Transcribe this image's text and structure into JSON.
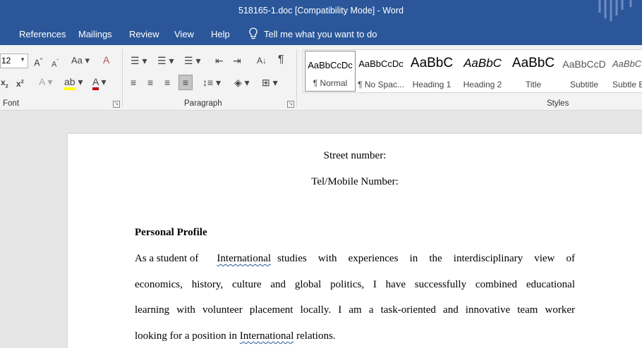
{
  "window": {
    "title": "518165-1.doc [Compatibility Mode]  -  Word"
  },
  "menu": {
    "tabs": [
      "References",
      "Mailings",
      "Review",
      "View",
      "Help"
    ],
    "tellme": "Tell me what you want to do"
  },
  "ribbon": {
    "font": {
      "size": "12",
      "group_label": "Font"
    },
    "paragraph": {
      "group_label": "Paragraph"
    },
    "styles": {
      "group_label": "Styles",
      "items": [
        {
          "preview": "AaBbCcDc",
          "name": "¶ Normal"
        },
        {
          "preview": "AaBbCcDc",
          "name": "¶ No Spac..."
        },
        {
          "preview": "AaBbC",
          "name": "Heading 1"
        },
        {
          "preview": "AaBbC",
          "name": "Heading 2"
        },
        {
          "preview": "AaBbC",
          "name": "Title"
        },
        {
          "preview": "AaBbCcD",
          "name": "Subtitle"
        },
        {
          "preview": "AaBbC",
          "name": "Subtle E"
        }
      ]
    }
  },
  "document": {
    "street": "Street number:",
    "tel": "Tel/Mobile Number:",
    "heading": "Personal Profile",
    "para": {
      "l1_a": "As a student of",
      "l1_b": "International",
      "l1_c": "studies with experiences in the interdisciplinary view of",
      "l2": "economics, history, culture and global politics, I have successfully combined educational",
      "l3": "learning with volunteer placement locally. I am a task-oriented and innovative team worker",
      "l4_a": "looking for a position in",
      "l4_b": "International",
      "l4_c": "relations."
    }
  },
  "colors": {
    "accent": "#2b579a",
    "ribbon_bg": "#f3f3f3",
    "canvas_bg": "#e6e6e6"
  }
}
